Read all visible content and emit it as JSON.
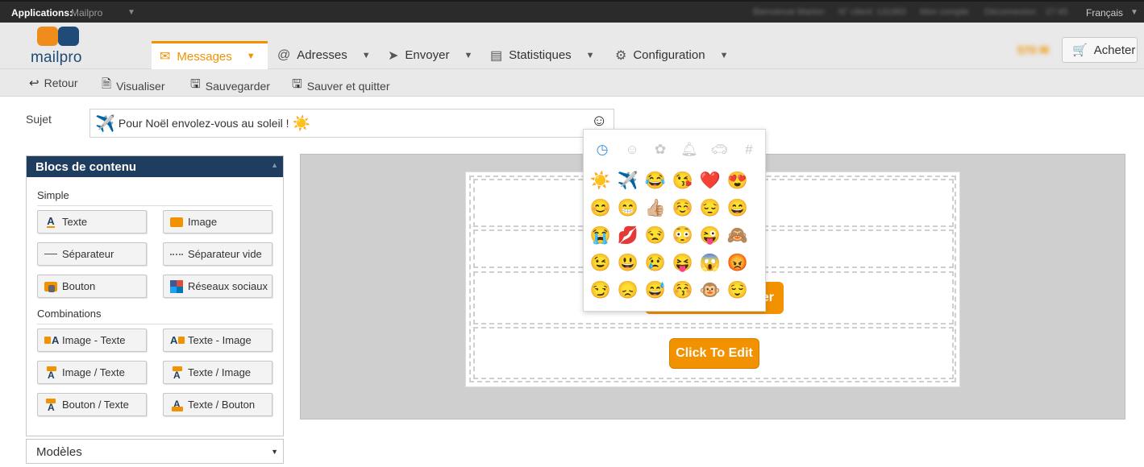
{
  "topbar": {
    "applications_label": "Applications:",
    "applications_value": "Mailpro",
    "blurred_items": [
      "Bienvenue Marion",
      "N° client: 131963",
      "Mon compte",
      "Déconnexion",
      "27:45"
    ],
    "language": "Français"
  },
  "logo": {
    "word": "mailpro"
  },
  "nav": {
    "messages": "Messages",
    "adresses": "Adresses",
    "envoyer": "Envoyer",
    "statistiques": "Statistiques",
    "configuration": "Configuration"
  },
  "credits_blurred": "570 ✉",
  "buy_label": "Acheter",
  "toolbar": {
    "back": "Retour",
    "preview": "Visualiser",
    "save": "Sauvegarder",
    "save_quit": "Sauver et quitter"
  },
  "subject": {
    "label": "Sujet",
    "emoji_start": "✈️",
    "text": "Pour Noël envolez-vous au soleil !",
    "emoji_end": "☀️",
    "smiley_toggle": "☺"
  },
  "panel": {
    "title": "Blocs de contenu",
    "simple_label": "Simple",
    "combinations_label": "Combinations",
    "simple_blocks": [
      "Texte",
      "Image",
      "Séparateur",
      "Séparateur vide",
      "Bouton",
      "Réseaux sociaux"
    ],
    "combo_blocks": [
      "Image - Texte",
      "Texte - Image",
      "Image / Texte",
      "Texte / Image",
      "Bouton / Texte",
      "Texte / Bouton"
    ]
  },
  "models_label": "Modèles",
  "canvas": {
    "edit_button": "Click To Edit",
    "hidden_button_tail": "er"
  },
  "picker": {
    "categories": [
      "clock-icon",
      "smiley-icon",
      "flower-icon",
      "bell-icon",
      "car-icon",
      "hash-icon"
    ],
    "emojis": [
      [
        "☀️",
        "✈️",
        "😂",
        "😘",
        "❤️",
        "😍"
      ],
      [
        "😊",
        "😁",
        "👍🏼",
        "☺️",
        "😔",
        "😄"
      ],
      [
        "😭",
        "💋",
        "😒",
        "😳",
        "😜",
        "🙈"
      ],
      [
        "😉",
        "😃",
        "😢",
        "😝",
        "😱",
        "😡"
      ],
      [
        "😏",
        "😞",
        "😅",
        "😚",
        "🐵",
        "😌"
      ]
    ]
  },
  "colors": {
    "accent": "#f39200",
    "brand_dark": "#1f3e5f",
    "header_bg": "#e9e9e9",
    "picker_active": "#3a8edb"
  }
}
